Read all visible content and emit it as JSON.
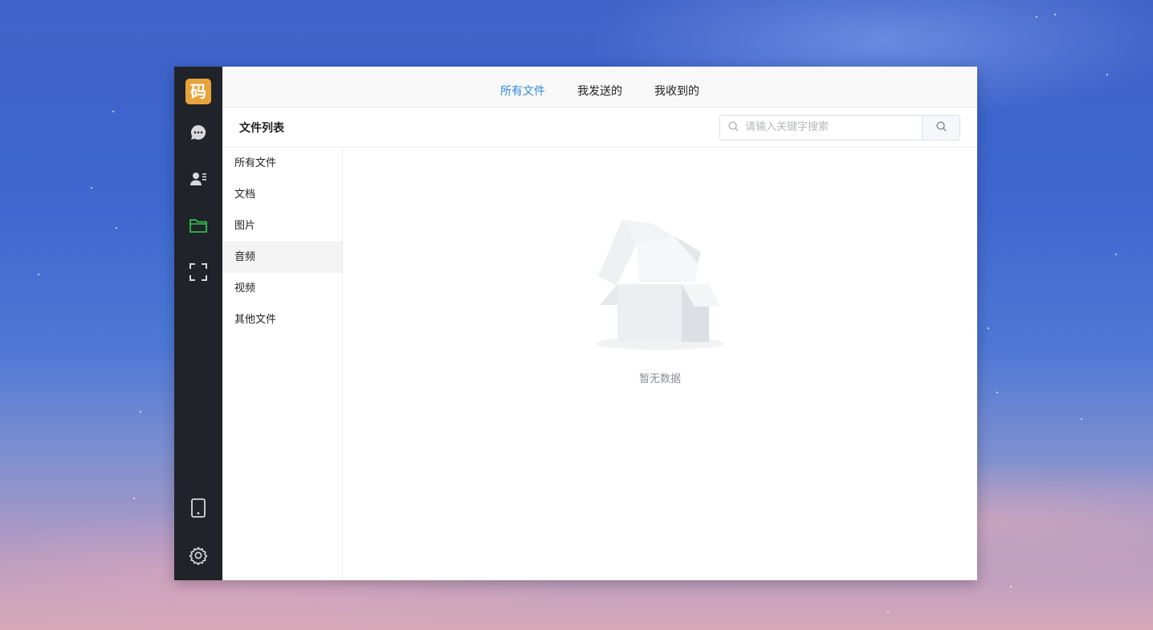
{
  "app": {
    "logo_text": "码"
  },
  "rail": {
    "top": [
      {
        "name": "chat",
        "icon": "chat-bubble-icon"
      },
      {
        "name": "contacts",
        "icon": "contact-card-icon"
      },
      {
        "name": "files",
        "icon": "folder-icon",
        "active": true
      },
      {
        "name": "scan",
        "icon": "fullscreen-frame-icon"
      }
    ],
    "bottom": [
      {
        "name": "phone",
        "icon": "mobile-phone-icon"
      },
      {
        "name": "settings",
        "icon": "gear-icon"
      }
    ]
  },
  "tabs": [
    "所有文件",
    "我发送的",
    "我收到的"
  ],
  "active_tab": "所有文件",
  "header": {
    "title": "文件列表"
  },
  "search": {
    "placeholder": "请输入关键字搜索"
  },
  "categories": [
    "所有文件",
    "文档",
    "图片",
    "音频",
    "视频",
    "其他文件"
  ],
  "selected_category": "音频",
  "empty": {
    "text": "暂无数据"
  },
  "colors": {
    "accent": "#2f8ae0",
    "rail_bg": "#20232a",
    "logo_bg": "#e9a33b",
    "active_icon": "#2fbf4a"
  }
}
